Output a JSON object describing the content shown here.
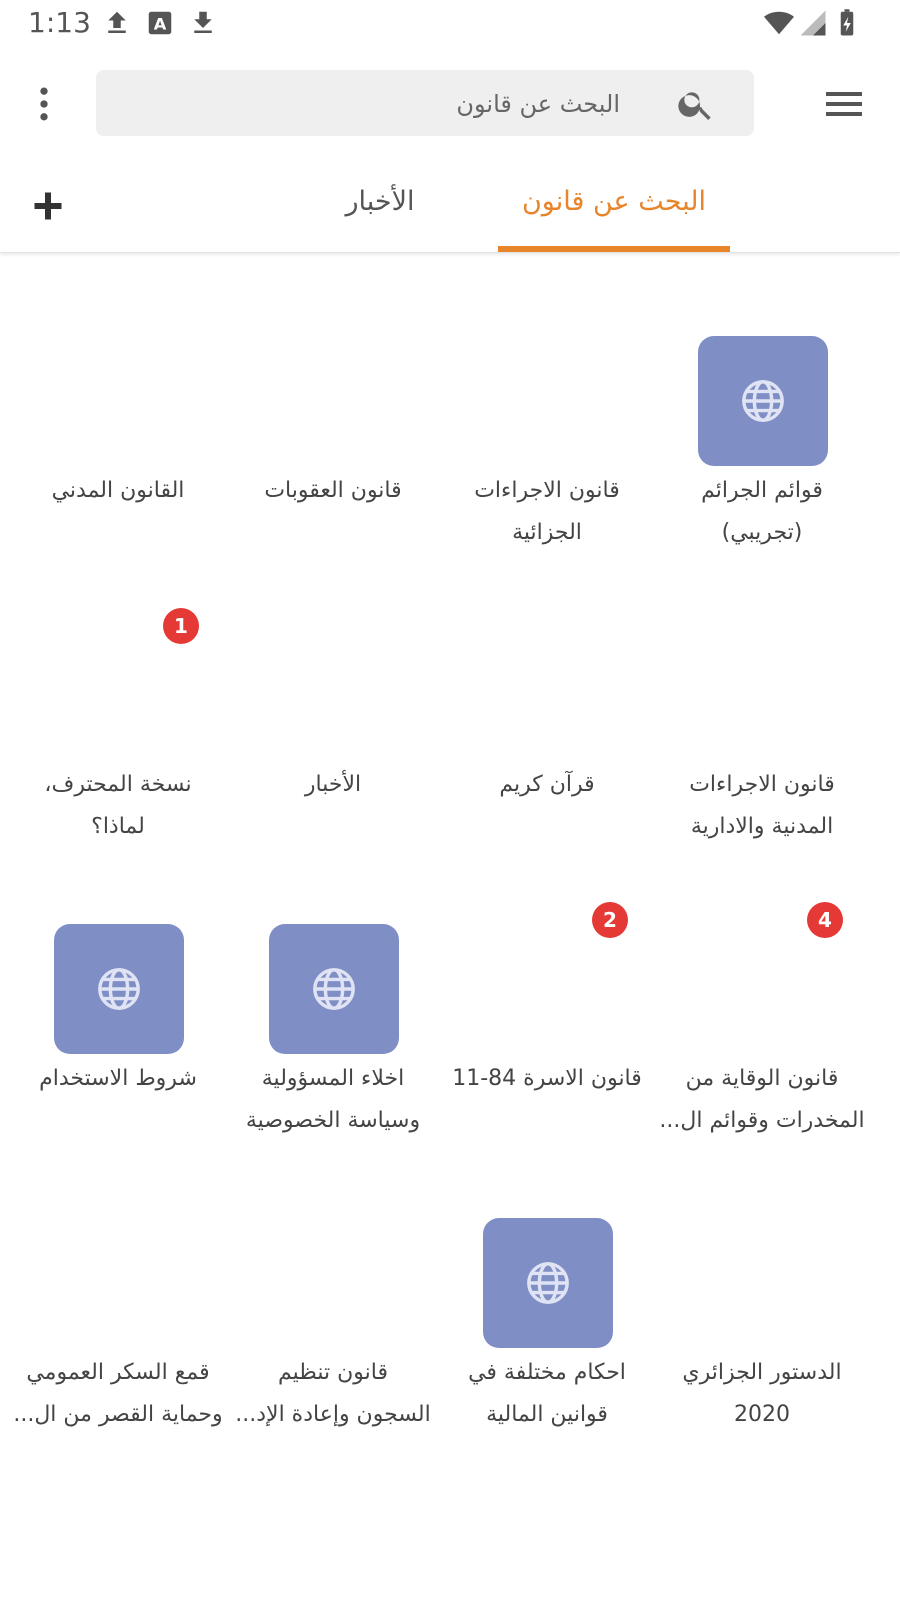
{
  "status_bar": {
    "time": "1:13",
    "icons": [
      "upload-icon",
      "text-a-icon",
      "download-icon",
      "wifi-icon",
      "signal-icon",
      "battery-icon"
    ]
  },
  "app_bar": {
    "search_placeholder": "البحث عن قانون",
    "icons": [
      "more-vert-icon",
      "search-icon",
      "menu-icon"
    ]
  },
  "tabs": [
    {
      "label": "البحث عن قانون",
      "active": true
    },
    {
      "label": "الأخبار",
      "active": false
    }
  ],
  "colors": {
    "accent": "#e8842a",
    "tile": "#7f8fc6",
    "badge": "#e53935"
  },
  "grid": {
    "items": [
      {
        "line1": "قوائم الجرائم",
        "line2": "(تجريبي)",
        "icon": "globe-icon",
        "badge": ""
      },
      {
        "line1": "قانون الاجراءات",
        "line2": "الجزائية",
        "icon": "",
        "badge": ""
      },
      {
        "line1": "قانون العقوبات",
        "line2": "",
        "icon": "",
        "badge": ""
      },
      {
        "line1": "القانون المدني",
        "line2": "",
        "icon": "",
        "badge": ""
      },
      {
        "line1": "قانون الاجراءات",
        "line2": "المدنية والادارية",
        "icon": "",
        "badge": ""
      },
      {
        "line1": "قرآن كريم",
        "line2": "",
        "icon": "",
        "badge": ""
      },
      {
        "line1": "الأخبار",
        "line2": "",
        "icon": "",
        "badge": ""
      },
      {
        "line1": "نسخة المحترف،",
        "line2": "لماذا؟",
        "icon": "",
        "badge": "1"
      },
      {
        "line1": "قانون الوقاية من",
        "line2": "المخدرات وقوائم ال...",
        "icon": "",
        "badge": "4"
      },
      {
        "line1": "قانون الاسرة 84-11",
        "line2": "",
        "icon": "",
        "badge": "2"
      },
      {
        "line1": "اخلاء المسؤولية",
        "line2": "وسياسة الخصوصية",
        "icon": "globe-icon",
        "badge": ""
      },
      {
        "line1": "شروط الاستخدام",
        "line2": "",
        "icon": "globe-icon",
        "badge": ""
      },
      {
        "line1": "الدستور الجزائري",
        "line2": "2020",
        "icon": "",
        "badge": ""
      },
      {
        "line1": "احكام مختلفة في",
        "line2": "قوانين المالية",
        "icon": "globe-icon",
        "badge": ""
      },
      {
        "line1": "قانون تنظيم",
        "line2": "السجون وإعادة الإد...",
        "icon": "",
        "badge": ""
      },
      {
        "line1": "قمع السكر العمومي",
        "line2": "وحماية القصر من ال...",
        "icon": "",
        "badge": ""
      }
    ]
  }
}
